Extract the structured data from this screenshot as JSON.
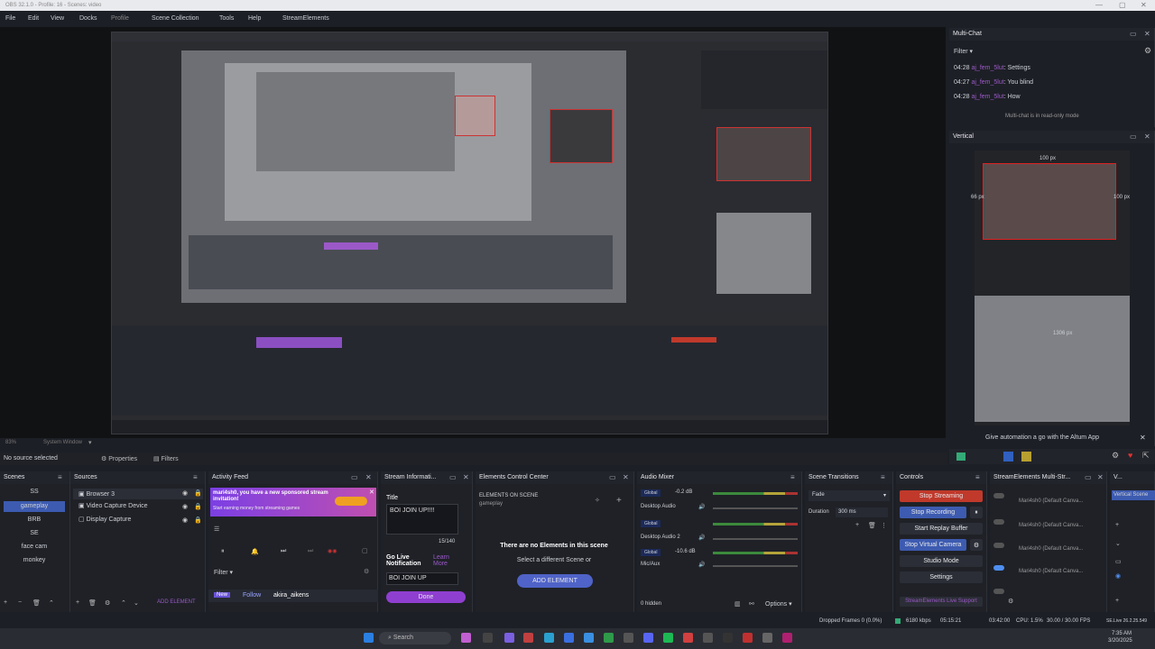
{
  "window": {
    "title": "OBS 32.1.0 - Profile: 16 - Scenes: video"
  },
  "menu": [
    "File",
    "Edit",
    "View",
    "Docks",
    "Profile",
    "Scene Collection",
    "Tools",
    "Help",
    "StreamElements"
  ],
  "multichat": {
    "title": "Multi-Chat",
    "filter": "Filter",
    "messages": [
      {
        "time": "04:28",
        "user": "aj_fem_5lut",
        "text": "Settings"
      },
      {
        "time": "04:27",
        "user": "aj_fem_5lut",
        "text": "You blind"
      },
      {
        "time": "04:28",
        "user": "aj_fem_5lut",
        "text": "How"
      }
    ],
    "readonly": "Multi-chat is in read-only mode"
  },
  "vertical": {
    "title": "Vertical",
    "px_top": "100 px",
    "px_left": "66 px",
    "px_right": "100 px",
    "px_mid": "1306 px",
    "automation": "Give automation a go with the Altum App"
  },
  "statusline": {
    "zoom": "83%",
    "system": "System Window"
  },
  "no_source": "No source selected",
  "props_tabs": {
    "properties": "Properties",
    "filters": "Filters"
  },
  "scenes": {
    "title": "Scenes",
    "items": [
      "SS",
      "gameplay",
      "BRB",
      "SE",
      "face cam",
      "monkey"
    ],
    "selected": 1
  },
  "sources": {
    "title": "Sources",
    "items": [
      "Browser 3",
      "Video Capture Device",
      "Display Capture"
    ]
  },
  "activity": {
    "title": "Activity Feed",
    "banner_line1": "mari4sh0, you have a new sponsored stream",
    "banner_line2": "invitation!",
    "banner_line3": "Start earning money from streaming games",
    "banner_btn": "",
    "filter": "Filter",
    "new": "New",
    "follow": "Follow",
    "user": "akira_aikens"
  },
  "streaminfo": {
    "title": "Stream Informati...",
    "label_title": "Title",
    "title_value": "BOI JOIN UP!!!!",
    "count": "15/140",
    "golive": "Go Live Notification",
    "learn": "Learn More",
    "golive_value": "BOI JOIN UP",
    "done": "Done"
  },
  "elements": {
    "title": "Elements Control Center",
    "subtitle": "ELEMENTS ON SCENE",
    "scene": "gameplay",
    "empty": "There are no Elements in this scene",
    "select": "Select a different Scene or",
    "add": "ADD ELEMENT"
  },
  "scene_add_element": "ADD ELEMENT",
  "mixer": {
    "title": "Audio Mixer",
    "hidden": "0 hidden",
    "options": "Options",
    "channels": [
      {
        "name": "Global",
        "db": "-0.2 dB"
      },
      {
        "name": "Desktop Audio",
        "db": ""
      },
      {
        "name": "Global",
        "db": ""
      },
      {
        "name": "Desktop Audio 2",
        "db": ""
      },
      {
        "name": "Global",
        "db": "-10.6 dB"
      },
      {
        "name": "Mic/Aux",
        "db": ""
      }
    ]
  },
  "transitions": {
    "title": "Scene Transitions",
    "type": "Fade",
    "duration_label": "Duration",
    "duration": "300 ms"
  },
  "controls": {
    "title": "Controls",
    "buttons": [
      "Stop Streaming",
      "Stop Recording",
      "Start Replay Buffer",
      "Stop Virtual Camera",
      "Studio Mode",
      "Settings"
    ],
    "support": "StreamElements Live Support"
  },
  "multistream": {
    "title": "StreamElements Multi-Str...",
    "items": [
      "Mari4sh0 (Default Canva...",
      "Mari4sh0 (Default Canva...",
      "Mari4sh0 (Default Canva...",
      "Mari4sh0 (Default Canva..."
    ]
  },
  "vertical_dock": {
    "title": "V...",
    "scene": "Vertical Scene"
  },
  "status": {
    "dropped": "Dropped Frames 0 (0.0%)",
    "kbps": "6180 kbps",
    "live": "05:15:21",
    "rec": "03:42:00",
    "cpu": "CPU: 1.5%",
    "fps": "30.00 / 30.00 FPS",
    "extra": "SE.Live 26.2.25.549"
  },
  "taskbar": {
    "search": "Search",
    "time": "7:35 AM",
    "date": "3/20/2025"
  }
}
